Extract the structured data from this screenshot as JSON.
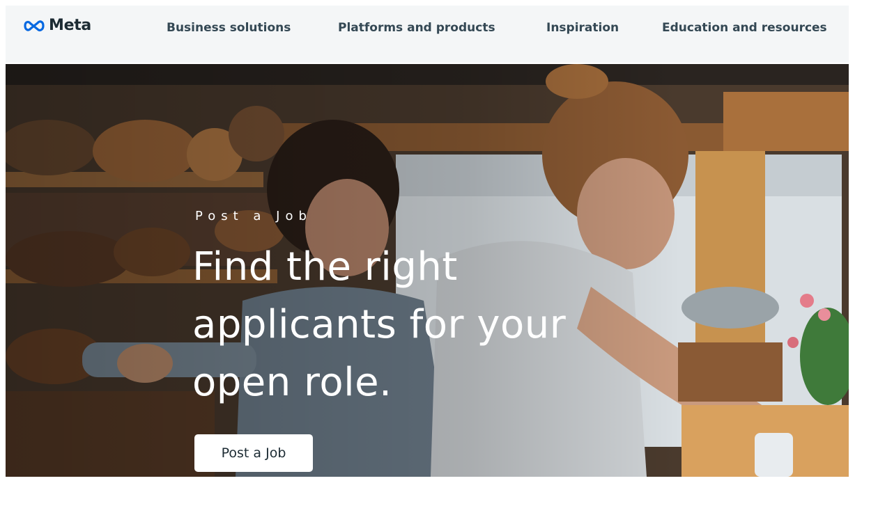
{
  "header": {
    "logo_text": "Meta",
    "nav": [
      {
        "label": "Business solutions"
      },
      {
        "label": "Platforms and products"
      },
      {
        "label": "Inspiration"
      },
      {
        "label": "Education and resources"
      }
    ]
  },
  "hero": {
    "eyebrow": "Post a Job",
    "headline": "Find the right applicants for your open role.",
    "cta_label": "Post a Job"
  },
  "colors": {
    "brand_blue": "#0668E1",
    "nav_text": "#344854",
    "header_bg": "#f4f6f7"
  }
}
